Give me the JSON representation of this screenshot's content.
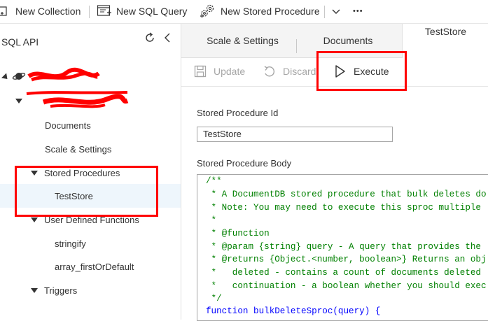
{
  "toolbar": {
    "new_collection": "New Collection",
    "new_sql_query": "New SQL Query",
    "new_stored_procedure": "New Stored Procedure",
    "more": "•••"
  },
  "sidebar": {
    "title": "SQL API",
    "items": [
      {
        "label": "Documents"
      },
      {
        "label": "Scale & Settings"
      },
      {
        "label": "Stored Procedures"
      },
      {
        "label": "TestStore"
      },
      {
        "label": "User Defined Functions"
      },
      {
        "label": "stringify"
      },
      {
        "label": "array_firstOrDefault"
      },
      {
        "label": "Triggers"
      }
    ]
  },
  "tabs": [
    {
      "label": "Scale & Settings"
    },
    {
      "label": "Documents"
    },
    {
      "label": "TestStore"
    }
  ],
  "commands": {
    "update": "Update",
    "discard": "Discard",
    "execute": "Execute"
  },
  "form": {
    "id_label": "Stored Procedure Id",
    "id_value": "TestStore",
    "body_label": "Stored Procedure Body"
  },
  "code": [
    "/**",
    " * A DocumentDB stored procedure that bulk deletes do",
    " * Note: You may need to execute this sproc multiple",
    " *",
    " * @function",
    " * @param {string} query - A query that provides the",
    " * @returns {Object.<number, boolean>} Returns an obj",
    " *   deleted - contains a count of documents deleted",
    " *   continuation - a boolean whether you should exec",
    " */",
    "function bulkDeleteSproc(query) {"
  ],
  "colors": {
    "highlight": "#ff0000",
    "selected_row": "#eef6fc",
    "comment": "#008000",
    "keyword": "#0000ff"
  }
}
